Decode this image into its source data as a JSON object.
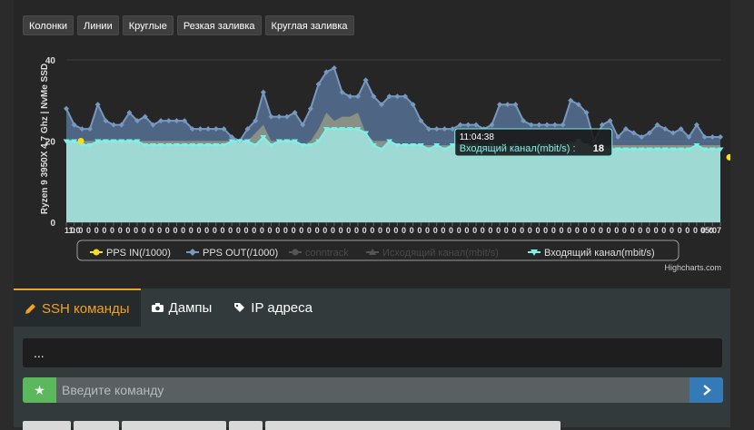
{
  "chart_type_buttons": [
    "Колонки",
    "Линии",
    "Круглые",
    "Резкая заливка",
    "Круглая заливка"
  ],
  "chart_data": {
    "type": "area",
    "ylabel": "Ryzen 9 3950X 4.7 Ghz | NvMe SSD",
    "y_ticks": [
      "0",
      "20",
      "40"
    ],
    "ylim": [
      0,
      40
    ],
    "x_start_label": "11:0",
    "x_end_label": "05:07",
    "series": [
      {
        "name": "PPS IN(/1000)",
        "color": "#f7e018",
        "marker": "circle",
        "visible": true,
        "values": [
          20,
          20,
          20,
          20,
          20,
          20,
          20,
          20,
          20,
          20,
          20,
          20,
          20,
          20,
          20,
          20,
          20,
          20,
          20,
          20,
          20,
          20,
          20,
          20,
          20,
          20,
          20,
          20,
          20,
          20,
          20,
          20,
          20,
          20,
          20,
          20,
          20,
          20,
          20,
          20,
          20,
          20,
          20,
          20,
          20,
          20,
          20,
          20,
          20,
          20,
          20,
          20,
          20,
          20,
          20,
          20,
          20,
          20,
          20,
          20,
          20,
          20,
          20,
          20,
          20,
          20,
          20,
          20,
          20,
          20,
          20,
          20,
          20,
          20,
          20,
          20,
          20,
          20,
          20,
          20,
          20,
          20,
          20,
          16
        ]
      },
      {
        "name": "PPS OUT(/1000)",
        "color": "#7798bf",
        "marker": "diamond",
        "visible": true,
        "values": [
          28,
          24,
          23,
          23,
          29,
          25,
          24,
          24,
          27,
          25,
          26,
          24,
          25,
          25,
          25,
          25,
          23,
          23,
          23,
          23,
          23,
          21,
          20,
          23,
          25,
          32,
          26,
          26,
          26,
          27,
          24,
          28,
          34,
          37,
          38,
          32,
          31,
          31,
          35,
          31,
          29,
          31,
          31,
          31,
          29,
          25,
          23,
          23,
          23,
          23,
          24,
          24,
          24,
          23,
          24,
          29,
          29,
          29,
          25,
          24,
          24,
          24,
          24,
          24,
          30,
          29,
          27,
          20,
          24,
          25,
          21,
          23,
          22,
          21,
          22,
          24,
          23,
          22,
          23,
          21,
          24,
          21,
          21,
          21
        ]
      },
      {
        "name": "conntrack",
        "color": "#55bf3b",
        "marker": "circle",
        "visible": false,
        "values": []
      },
      {
        "name": "Исходящий канал(mbit/s)",
        "color": "#aaa37a",
        "marker": "triangle",
        "visible": false,
        "values": [
          20,
          20,
          20,
          20,
          20,
          20,
          20,
          20,
          20,
          20,
          20,
          20,
          20,
          20,
          20,
          20,
          20,
          20,
          20,
          20,
          20,
          20,
          20,
          20,
          22,
          24,
          20,
          20,
          20,
          20,
          19,
          20,
          23,
          27,
          25,
          26,
          26,
          27,
          22,
          20,
          20,
          20,
          19,
          19,
          19,
          19,
          19,
          19,
          19,
          19,
          19,
          19,
          19,
          19,
          19,
          19,
          19,
          19,
          19,
          19,
          19,
          19,
          19,
          19,
          20,
          19,
          19,
          19,
          19,
          19,
          19,
          19,
          19,
          19,
          19,
          19,
          19,
          19,
          19,
          19,
          19,
          19,
          19,
          19
        ]
      },
      {
        "name": "Входящий канал(mbit/s)",
        "color": "#7ff0e8",
        "marker": "triangle-down",
        "visible": true,
        "values": [
          20,
          20,
          19,
          19,
          20,
          20,
          20,
          20,
          20,
          20,
          19,
          19,
          19,
          19,
          19,
          19,
          19,
          19,
          19,
          19,
          19,
          20,
          20,
          20,
          19,
          21,
          19,
          20,
          20,
          20,
          19,
          19,
          20,
          23,
          23,
          23,
          23,
          23,
          22,
          19,
          18,
          20,
          19,
          19,
          19,
          19,
          18,
          19,
          18,
          19,
          19,
          19,
          19,
          18,
          19,
          18,
          18,
          19,
          18,
          18,
          19,
          19,
          19,
          19,
          19,
          20,
          19,
          18,
          18,
          18,
          18,
          18,
          18,
          18,
          18,
          18,
          18,
          18,
          18,
          18,
          19,
          18,
          18,
          18
        ]
      }
    ],
    "tooltip": {
      "time": "11:04:38",
      "series_label": "Входящий канал(mbit/s)",
      "value": "18",
      "index": 50
    },
    "legend_placement": "bottom"
  },
  "credits": "Highcharts.com",
  "tabs": [
    {
      "label": "SSH команды",
      "active": true
    },
    {
      "label": "Дампы",
      "active": false
    },
    {
      "label": "IP адреса",
      "active": false
    }
  ],
  "output_text": "...",
  "command_input": {
    "placeholder": "Введите команду",
    "value": ""
  },
  "quick_command_count": 7
}
